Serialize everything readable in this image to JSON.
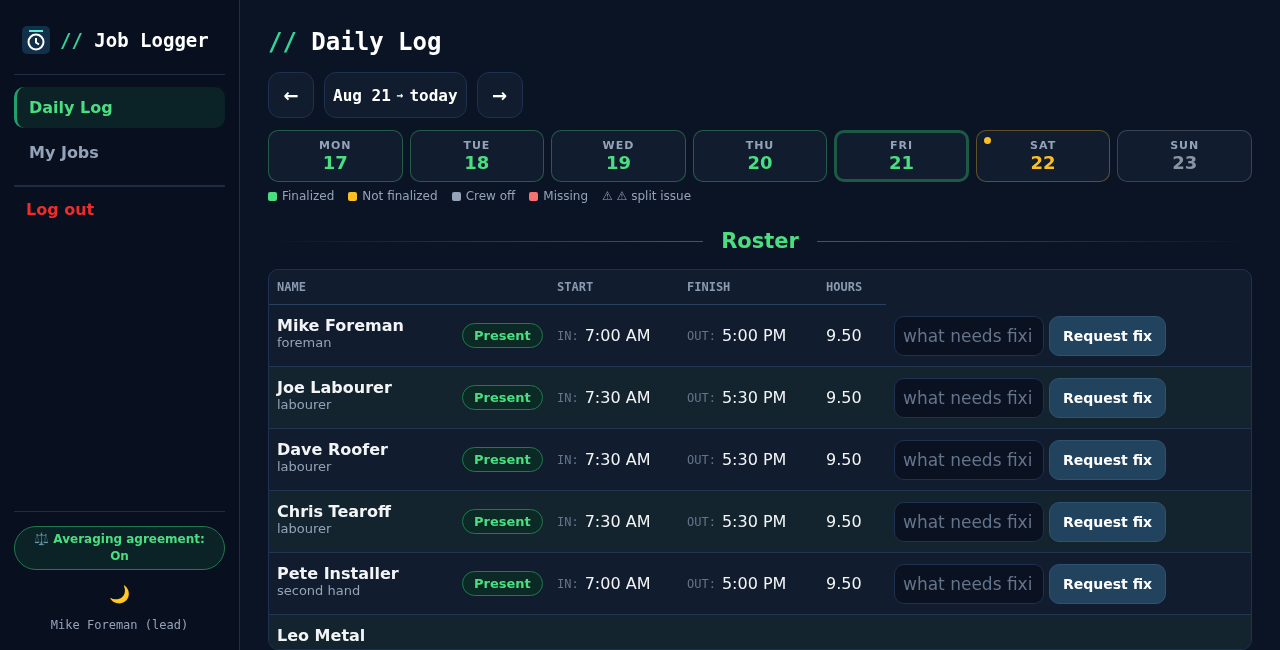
{
  "sidebar": {
    "app_title_prefix": "//",
    "app_title": "Job Logger",
    "nav": [
      {
        "label": "Daily Log",
        "selected": true
      },
      {
        "label": "My Jobs",
        "selected": false
      }
    ],
    "logout": "Log out",
    "agreement_badge": "⚖️ Averaging agreement: On",
    "theme_icon": "🌙",
    "user": "Mike Foreman (lead)"
  },
  "page_title_prefix": "//",
  "page_title": "Daily Log",
  "date_nav": {
    "prev": "←",
    "range": "Aug 21",
    "range_arrow": "→",
    "range_end": "today",
    "next": "→"
  },
  "days": [
    {
      "weekday": "MON",
      "date": "17",
      "color": "#4ade80",
      "flagged": false,
      "selected": false
    },
    {
      "weekday": "TUE",
      "date": "18",
      "color": "#4ade80",
      "flagged": false,
      "selected": false
    },
    {
      "weekday": "WED",
      "date": "19",
      "color": "#4ade80",
      "flagged": false,
      "selected": false
    },
    {
      "weekday": "THU",
      "date": "20",
      "color": "#4ade80",
      "flagged": false,
      "selected": false
    },
    {
      "weekday": "FRI",
      "date": "21",
      "color": "#4ade80",
      "flagged": false,
      "selected": true
    },
    {
      "weekday": "SAT",
      "date": "22",
      "color": "#fbbf24",
      "flagged": true,
      "selected": false
    },
    {
      "weekday": "SUN",
      "date": "23",
      "color": "#8b94a3",
      "flagged": false,
      "selected": false
    }
  ],
  "legend": [
    {
      "kind": "dot",
      "label": "Finalized",
      "color": "#4ade80"
    },
    {
      "kind": "dot",
      "label": "Not finalized",
      "color": "#fbbf24"
    },
    {
      "kind": "dot",
      "label": "Crew off",
      "color": "#94a3b8"
    },
    {
      "kind": "dot",
      "label": "Missing",
      "color": "#f87171"
    },
    {
      "kind": "text",
      "label": "⚠ ⚠ split issue"
    }
  ],
  "section_title": "Roster",
  "table": {
    "columns": [
      "NAME",
      "START",
      "FINISH",
      "HOURS"
    ],
    "rows": [
      {
        "name": "Mike Foreman",
        "role": "foreman",
        "status": "Present",
        "in_label": "IN:",
        "start": "7:00 AM",
        "out_label": "OUT:",
        "finish": "5:00 PM",
        "hours": "9.50",
        "placeholder": "what needs fixi",
        "action": "Request fix"
      },
      {
        "name": "Joe Labourer",
        "role": "labourer",
        "status": "Present",
        "in_label": "IN:",
        "start": "7:30 AM",
        "out_label": "OUT:",
        "finish": "5:30 PM",
        "hours": "9.50",
        "placeholder": "what needs fixi",
        "action": "Request fix"
      },
      {
        "name": "Dave Roofer",
        "role": "labourer",
        "status": "Present",
        "in_label": "IN:",
        "start": "7:30 AM",
        "out_label": "OUT:",
        "finish": "5:30 PM",
        "hours": "9.50",
        "placeholder": "what needs fixi",
        "action": "Request fix"
      },
      {
        "name": "Chris Tearoff",
        "role": "labourer",
        "status": "Present",
        "in_label": "IN:",
        "start": "7:30 AM",
        "out_label": "OUT:",
        "finish": "5:30 PM",
        "hours": "9.50",
        "placeholder": "what needs fixi",
        "action": "Request fix"
      },
      {
        "name": "Pete Installer",
        "role": "second hand",
        "status": "Present",
        "in_label": "IN:",
        "start": "7:00 AM",
        "out_label": "OUT:",
        "finish": "5:00 PM",
        "hours": "9.50",
        "placeholder": "what needs fixi",
        "action": "Request fix"
      },
      {
        "name": "Leo Metal"
      }
    ]
  }
}
